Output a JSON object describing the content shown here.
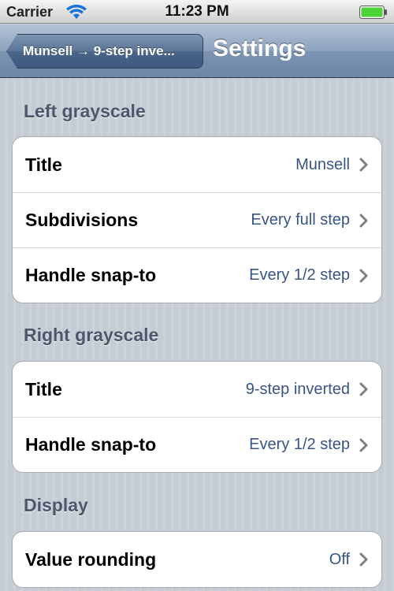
{
  "status_bar": {
    "carrier": "Carrier",
    "time": "11:23 PM",
    "icons": [
      "wifi-icon",
      "battery-icon"
    ],
    "battery_color": "#4fd33a"
  },
  "nav_bar": {
    "back_label": "Munsell → 9-step inve...",
    "title": "Settings"
  },
  "sections": [
    {
      "header": "Left grayscale",
      "rows": [
        {
          "label": "Title",
          "value": "Munsell"
        },
        {
          "label": "Subdivisions",
          "value": "Every full step"
        },
        {
          "label": "Handle snap-to",
          "value": "Every 1/2 step"
        }
      ]
    },
    {
      "header": "Right grayscale",
      "rows": [
        {
          "label": "Title",
          "value": "9-step inverted"
        },
        {
          "label": "Handle snap-to",
          "value": "Every 1/2 step"
        }
      ]
    },
    {
      "header": "Display",
      "rows": [
        {
          "label": "Value rounding",
          "value": "Off"
        }
      ]
    }
  ],
  "colors": {
    "value_text": "#385487",
    "section_header": "#4c566c",
    "nav_bar": "#6d85a6"
  }
}
